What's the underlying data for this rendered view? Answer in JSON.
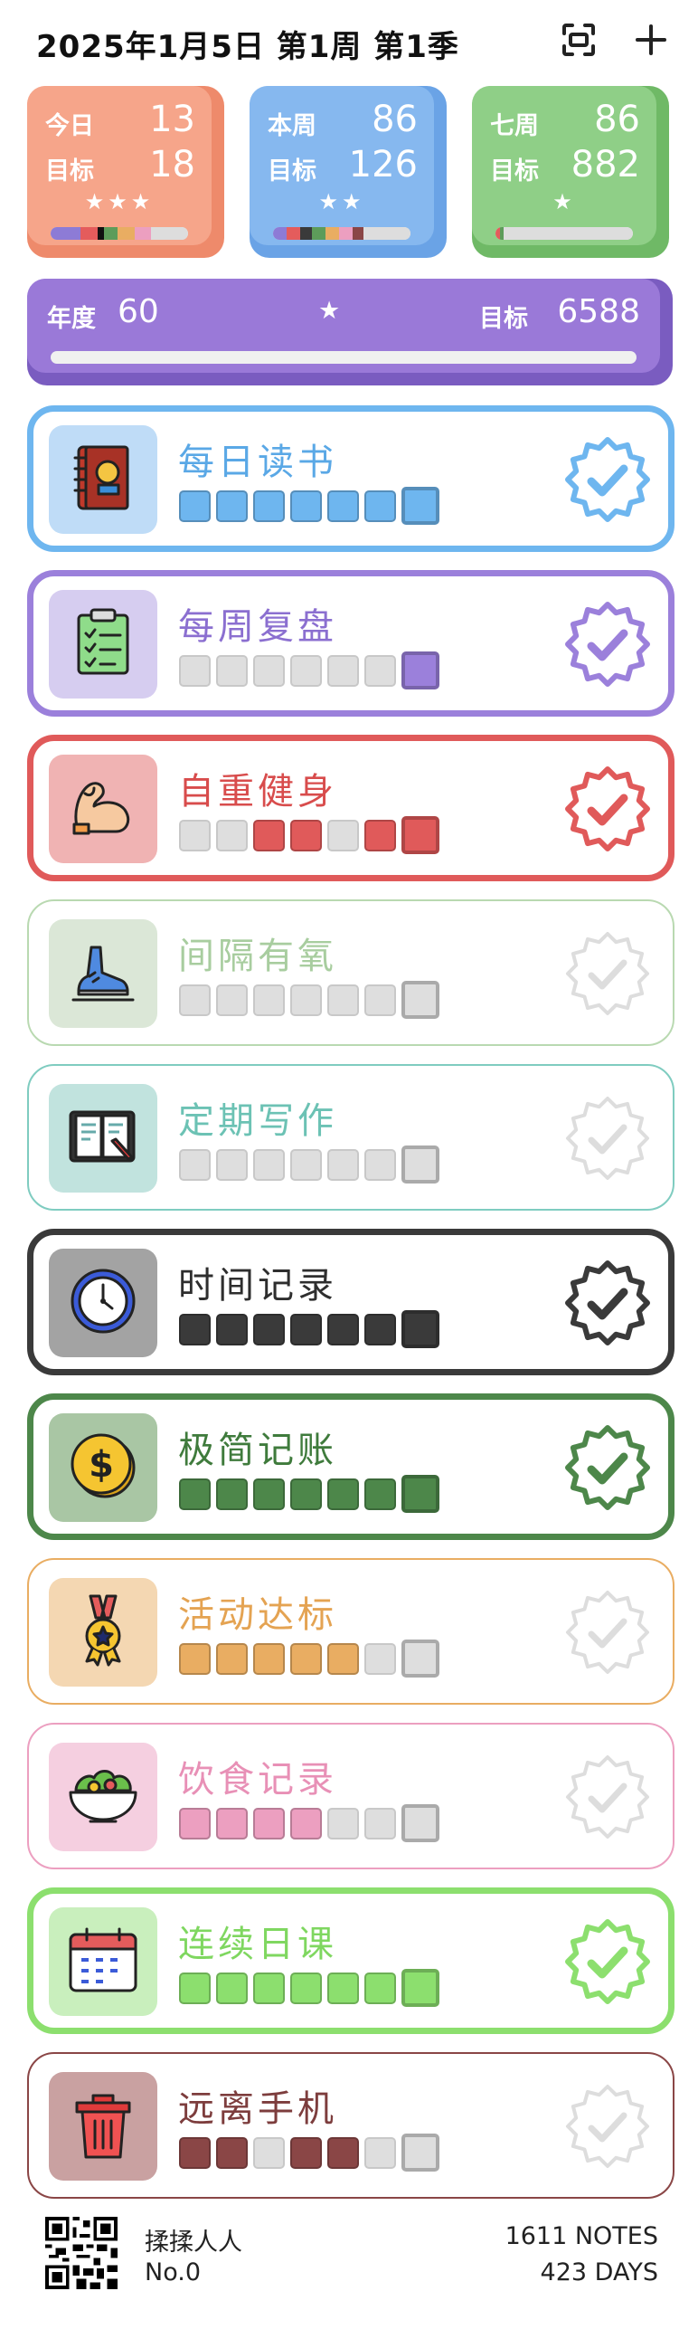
{
  "header": {
    "title": "2025年1月5日 第1周 第1季",
    "scan_icon": "scan-icon",
    "add_icon": "plus-icon"
  },
  "stats": [
    {
      "label_top": "今日",
      "value_top": "13",
      "label_bottom": "目标",
      "value_bottom": "18",
      "stars": "★★★",
      "color": "#f6a58a",
      "shadow": "#ee8a6b"
    },
    {
      "label_top": "本周",
      "value_top": "86",
      "label_bottom": "目标",
      "value_bottom": "126",
      "stars": "★★",
      "color": "#86b8ef",
      "shadow": "#6aa3e6"
    },
    {
      "label_top": "七周",
      "value_top": "86",
      "label_bottom": "目标",
      "value_bottom": "882",
      "stars": "★",
      "color": "#8fcf87",
      "shadow": "#6fb966"
    }
  ],
  "year": {
    "label": "年度",
    "value": "60",
    "stars": "★",
    "goal_label": "目标",
    "goal_value": "6588"
  },
  "habits": [
    {
      "name": "每日读书",
      "icon": "book-icon",
      "color": "#6eb6ef",
      "name_color": "#5aa8e6",
      "icon_bg": "#bfdcf7",
      "state": [
        1,
        1,
        1,
        1,
        1,
        1,
        1
      ],
      "done": true
    },
    {
      "name": "每周复盘",
      "icon": "checklist-icon",
      "color": "#9b80db",
      "name_color": "#8b6fd0",
      "icon_bg": "#d6cdf0",
      "state": [
        0,
        0,
        0,
        0,
        0,
        0,
        1
      ],
      "done": true
    },
    {
      "name": "自重健身",
      "icon": "muscle-arm-icon",
      "color": "#e05a5a",
      "name_color": "#d84c4c",
      "icon_bg": "#f0b3b3",
      "state": [
        0,
        0,
        1,
        1,
        0,
        1,
        1
      ],
      "done": true
    },
    {
      "name": "间隔有氧",
      "icon": "running-shoe-icon",
      "color": "#b9d9b1",
      "name_color": "#a8cd9f",
      "icon_bg": "#dbe7d7",
      "state": [
        0,
        0,
        0,
        0,
        0,
        0,
        0
      ],
      "done": false
    },
    {
      "name": "定期写作",
      "icon": "writing-notebook-icon",
      "color": "#7fccc0",
      "name_color": "#6cc2b4",
      "icon_bg": "#c1e3de",
      "state": [
        0,
        0,
        0,
        0,
        0,
        0,
        0
      ],
      "done": false
    },
    {
      "name": "时间记录",
      "icon": "clock-icon",
      "color": "#3a3a3a",
      "name_color": "#2e2e2e",
      "icon_bg": "#a3a3a3",
      "state": [
        1,
        1,
        1,
        1,
        1,
        1,
        1
      ],
      "done": true
    },
    {
      "name": "极简记账",
      "icon": "dollar-coin-icon",
      "color": "#4d874a",
      "name_color": "#3f7b3c",
      "icon_bg": "#a9c6a4",
      "state": [
        1,
        1,
        1,
        1,
        1,
        1,
        1
      ],
      "done": true
    },
    {
      "name": "活动达标",
      "icon": "medal-icon",
      "color": "#e9ad62",
      "name_color": "#e4a352",
      "icon_bg": "#f4d7b2",
      "state": [
        1,
        1,
        1,
        1,
        1,
        0,
        0
      ],
      "done": false
    },
    {
      "name": "饮食记录",
      "icon": "salad-bowl-icon",
      "color": "#ec9fc0",
      "name_color": "#e890b6",
      "icon_bg": "#f5cfe0",
      "state": [
        1,
        1,
        1,
        1,
        0,
        0,
        0
      ],
      "done": false
    },
    {
      "name": "连续日课",
      "icon": "calendar-icon",
      "color": "#8cdf6e",
      "name_color": "#7fd760",
      "icon_bg": "#c9efbd",
      "state": [
        1,
        1,
        1,
        1,
        1,
        1,
        1
      ],
      "done": true
    },
    {
      "name": "远离手机",
      "icon": "trash-bin-icon",
      "color": "#8a4646",
      "name_color": "#7d3d3d",
      "icon_bg": "#c9a1a1",
      "state": [
        1,
        1,
        0,
        1,
        1,
        0,
        0
      ],
      "done": false
    }
  ],
  "footer": {
    "user_name": "揉揉人人",
    "user_no": "No.0",
    "notes": "1611 NOTES",
    "days": "423 DAYS"
  }
}
